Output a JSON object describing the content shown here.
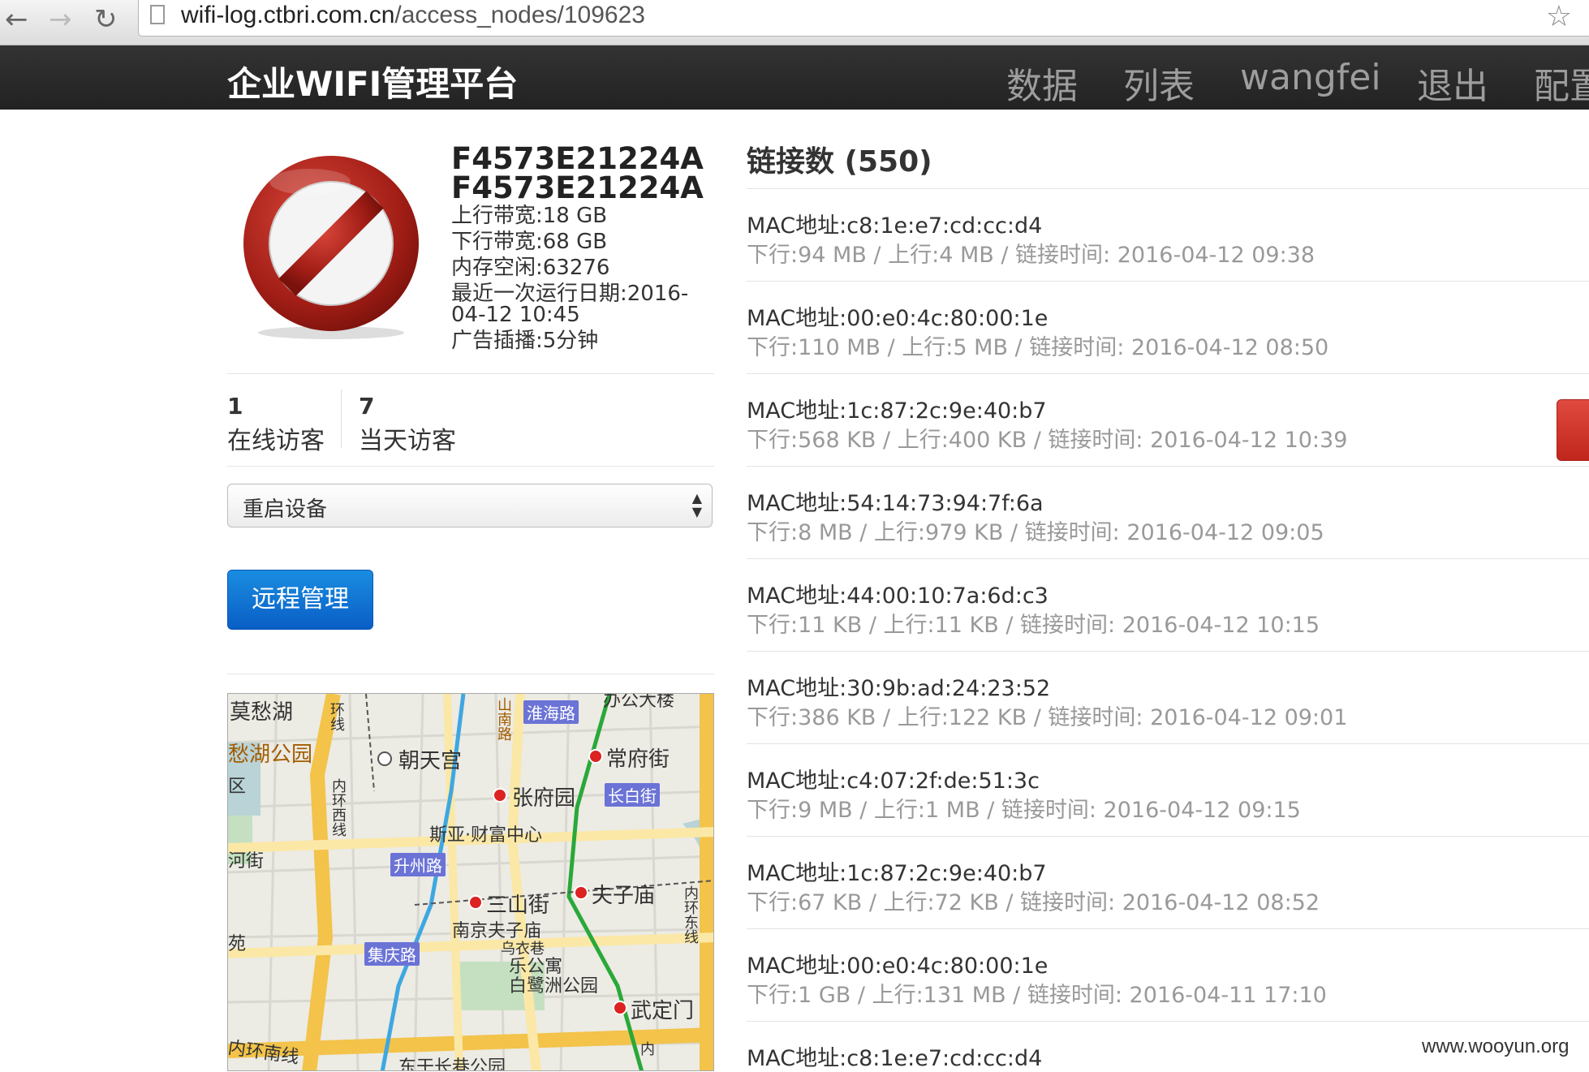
{
  "browser": {
    "url_host": "wifi-log.ctbri.com.cn",
    "url_path": "/access_nodes/109623",
    "back_icon": "back-arrow-icon",
    "forward_icon": "forward-arrow-icon",
    "reload_icon": "reload-icon"
  },
  "navbar": {
    "brand": "企业WIFI管理平台",
    "items": [
      {
        "label": "数据"
      },
      {
        "label": "列表"
      },
      {
        "label": "wangfei"
      },
      {
        "label": "退出"
      },
      {
        "label": "配置"
      }
    ]
  },
  "node": {
    "status_icon": "blocked-icon",
    "id_line1": "F4573E21224A",
    "id_line2": "F4573E21224A",
    "upload_bandwidth": "上行带宽:18 GB",
    "download_bandwidth": "下行带宽:68 GB",
    "memory_free": "内存空闲:63276",
    "last_run_line1": "最近一次运行日期:2016-",
    "last_run_line2": "04-12 10:45",
    "ad_broadcast": "广告插播:5分钟"
  },
  "stats": {
    "online_count": "1",
    "online_label": "在线访客",
    "today_count": "7",
    "today_label": "当天访客"
  },
  "actions": {
    "select_value": "重启设备",
    "remote_button": "远程管理"
  },
  "map": {
    "labels": {
      "moc_lake": "莫愁湖",
      "moc_park": "愁湖公园",
      "qu": "区",
      "chaotiangong": "朝天宫",
      "changfujie": "常府街",
      "zhangfuyuan": "张府园",
      "sia": "斯亚·财富中心",
      "sanshanjie": "三山街",
      "fuzimiao": "夫子庙",
      "nanjing_fzm": "南京夫子庙",
      "wuyixiang": "乌衣巷",
      "baiyuzhou": "白鹭洲公园",
      "wudingmen": "武定门",
      "dongganchang": "东干长巷公园",
      "bangong": "办公大楼",
      "hejie": "河街",
      "yuan": "苑",
      "legongyu": "乐公寓",
      "neihuanxi": "内环西线",
      "neihuandong": "内环东线",
      "neihuannan": "内环南线",
      "huanxian": "环线",
      "shannanlu": "山南路",
      "nei": "内"
    },
    "tags": {
      "huaihailu": "淮海路",
      "changbaijie": "长白街",
      "shengzhoulu": "升州路",
      "jiqinglu": "集庆路"
    }
  },
  "connections": {
    "title": "链接数 (550)",
    "items": [
      {
        "mac": "MAC地址:c8:1e:e7:cd:cc:d4",
        "detail": "下行:94 MB / 上行:4 MB / 链接时间: 2016-04-12 09:38"
      },
      {
        "mac": "MAC地址:00:e0:4c:80:00:1e",
        "detail": "下行:110 MB / 上行:5 MB / 链接时间: 2016-04-12 08:50"
      },
      {
        "mac": "MAC地址:1c:87:2c:9e:40:b7",
        "detail": "下行:568 KB / 上行:400 KB / 链接时间: 2016-04-12 10:39"
      },
      {
        "mac": "MAC地址:54:14:73:94:7f:6a",
        "detail": "下行:8 MB / 上行:979 KB / 链接时间: 2016-04-12 09:05"
      },
      {
        "mac": "MAC地址:44:00:10:7a:6d:c3",
        "detail": "下行:11 KB / 上行:11 KB / 链接时间: 2016-04-12 10:15"
      },
      {
        "mac": "MAC地址:30:9b:ad:24:23:52",
        "detail": "下行:386 KB / 上行:122 KB / 链接时间: 2016-04-12 09:01"
      },
      {
        "mac": "MAC地址:c4:07:2f:de:51:3c",
        "detail": "下行:9 MB / 上行:1 MB / 链接时间: 2016-04-12 09:15"
      },
      {
        "mac": "MAC地址:1c:87:2c:9e:40:b7",
        "detail": "下行:67 KB / 上行:72 KB / 链接时间: 2016-04-12 08:52"
      },
      {
        "mac": "MAC地址:00:e0:4c:80:00:1e",
        "detail": "下行:1 GB / 上行:131 MB / 链接时间: 2016-04-11 17:10"
      },
      {
        "mac": "MAC地址:c8:1e:e7:cd:cc:d4",
        "detail": ""
      }
    ]
  },
  "watermark": "www.wooyun.org",
  "colors": {
    "navbar_bg": "#222222",
    "primary_button": "#0a6cd0",
    "danger": "#c0261c"
  }
}
